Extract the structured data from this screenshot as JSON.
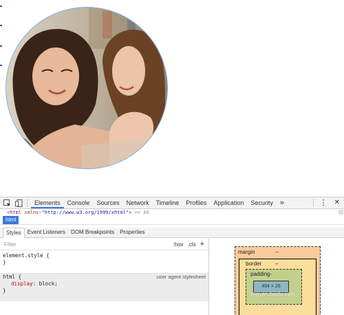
{
  "devtools": {
    "tabs": [
      "Elements",
      "Console",
      "Sources",
      "Network",
      "Timeline",
      "Profiles",
      "Application",
      "Security"
    ],
    "more_tabs": "»",
    "menu_icon": "⋮",
    "close_icon": "✕",
    "html_line": {
      "open": "<html",
      "attr_name": "xmlns",
      "attr_value": "\"http://www.w3.org/1999/xhtml\"",
      "close": ">",
      "equals": "== $0"
    },
    "breadcrumb": "html",
    "styles_tabs": [
      "Styles",
      "Event Listeners",
      "DOM Breakpoints",
      "Properties"
    ],
    "filter_placeholder": "Filter",
    "hov": ":hov",
    "cls": ".cls",
    "add": "+",
    "element_style": {
      "selector": "element.style {",
      "close": "}"
    },
    "html_rule": {
      "selector": "html {",
      "origin": "user agent stylesheet",
      "property": "display",
      "value": "block;",
      "close": "}"
    },
    "box_model": {
      "margin_label": "margin",
      "margin_value": "–",
      "border_label": "border",
      "border_value": "–",
      "padding_label": "padding-",
      "content": "494 × 26"
    },
    "watermark": "jingyan.baidu.com"
  },
  "colors": {
    "accent": "#3879d9",
    "circle_border": "#7fb0e4",
    "margin": "#f9cc9d",
    "border": "#fddd9b",
    "padding": "#c3d08b",
    "content": "#8cb6c0"
  }
}
